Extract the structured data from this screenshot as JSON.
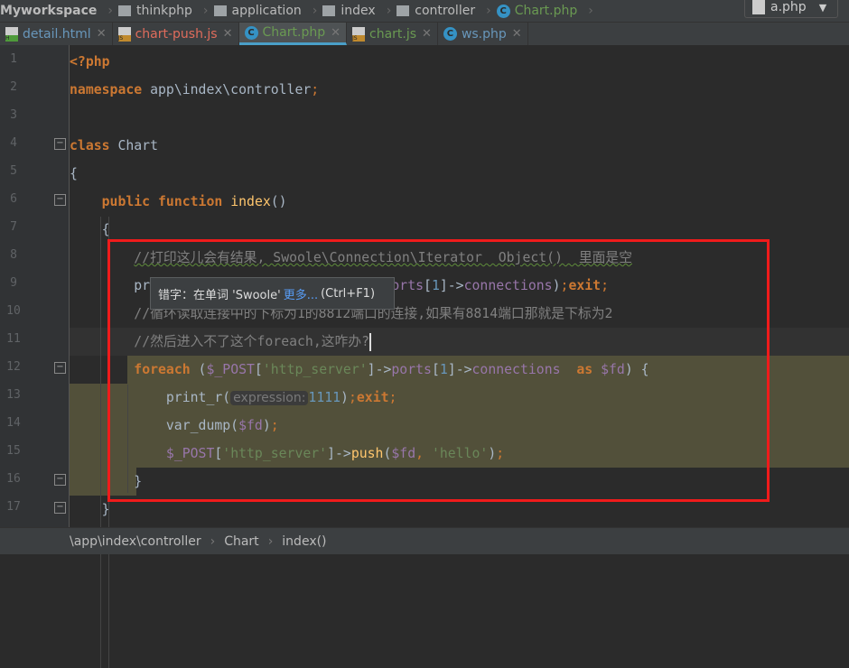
{
  "breadcrumb": {
    "items": [
      "Myworkspace",
      "thinkphp",
      "application",
      "index",
      "controller",
      "Chart.php"
    ]
  },
  "run_config": {
    "label": "a.php"
  },
  "tabs": [
    {
      "label": "detail.html",
      "color": "#6897bb",
      "icon": "html-file-icon",
      "badge": "H"
    },
    {
      "label": "chart-push.js",
      "color": "#e06c5c",
      "icon": "js-file-icon",
      "badge": "JS"
    },
    {
      "label": "Chart.php",
      "color": "#6a9a52",
      "icon": "php-class-icon",
      "badge": "C",
      "active": true
    },
    {
      "label": "chart.js",
      "color": "#6a9a52",
      "icon": "js-file-icon",
      "badge": "JS"
    },
    {
      "label": "ws.php",
      "color": "#6897bb",
      "icon": "php-class-icon",
      "badge": "C"
    }
  ],
  "line_numbers": [
    "1",
    "2",
    "3",
    "4",
    "5",
    "6",
    "7",
    "8",
    "9",
    "10",
    "11",
    "12",
    "13",
    "14",
    "15",
    "16",
    "17"
  ],
  "code": [
    [
      [
        "<?php",
        "tag"
      ]
    ],
    [
      [
        "namespace",
        "kw"
      ],
      [
        " app\\index\\controller",
        ""
      ],
      [
        ";",
        "semi"
      ]
    ],
    [],
    [
      [
        "class",
        "kw"
      ],
      [
        " Chart",
        ""
      ]
    ],
    [
      [
        "{",
        ""
      ]
    ],
    [
      [
        "    ",
        ""
      ],
      [
        "public",
        "kw"
      ],
      [
        " ",
        ""
      ],
      [
        "function",
        "kw"
      ],
      [
        " ",
        ""
      ],
      [
        "index",
        "fn"
      ],
      [
        "()",
        ""
      ]
    ],
    [
      [
        "    {",
        ""
      ]
    ],
    [
      [
        "        ",
        ""
      ],
      [
        "//打印这儿会有结果, Swoole\\Connection\\Iterator  Object()  里面是空",
        "cm"
      ]
    ],
    [
      [
        "        print_r(",
        ""
      ],
      [
        "$_POST",
        "var"
      ],
      [
        "[",
        ""
      ],
      [
        "'http_server'",
        "str"
      ],
      [
        "]->",
        ""
      ],
      [
        "ports",
        "var"
      ],
      [
        "[",
        ""
      ],
      [
        "1",
        "num"
      ],
      [
        "]->",
        ""
      ],
      [
        "connections",
        "var"
      ],
      [
        ")",
        ""
      ],
      [
        ";",
        "semi"
      ],
      [
        "exit",
        "kw"
      ],
      [
        ";",
        "semi"
      ]
    ],
    [
      [
        "        ",
        ""
      ],
      [
        "//循环读取连接中的下标为1的8812端口的连接,如果有8814端口那就是下标为2",
        "cm"
      ]
    ],
    [
      [
        "        ",
        ""
      ],
      [
        "//然后进入不了这个foreach,这咋办?",
        "cm"
      ]
    ],
    [
      [
        "        ",
        ""
      ],
      [
        "foreach",
        "kw"
      ],
      [
        " (",
        ""
      ],
      [
        "$_POST",
        "var"
      ],
      [
        "[",
        ""
      ],
      [
        "'http_server'",
        "str"
      ],
      [
        "]->",
        ""
      ],
      [
        "ports",
        "var"
      ],
      [
        "[",
        ""
      ],
      [
        "1",
        "num"
      ],
      [
        "]->",
        ""
      ],
      [
        "connections",
        "var"
      ],
      [
        "  ",
        ""
      ],
      [
        "as",
        "kw"
      ],
      [
        " ",
        ""
      ],
      [
        "$fd",
        "var"
      ],
      [
        ") {",
        ""
      ]
    ],
    [
      [
        "            print_r(",
        ""
      ],
      [
        "expression:",
        "hint"
      ],
      [
        "1111",
        "num"
      ],
      [
        ")",
        ""
      ],
      [
        ";",
        "semi"
      ],
      [
        "exit",
        "kw"
      ],
      [
        ";",
        "semi"
      ]
    ],
    [
      [
        "            var_dump(",
        ""
      ],
      [
        "$fd",
        "var"
      ],
      [
        ")",
        ""
      ],
      [
        ";",
        "semi"
      ]
    ],
    [
      [
        "            ",
        ""
      ],
      [
        "$_POST",
        "var"
      ],
      [
        "[",
        ""
      ],
      [
        "'http_server'",
        "str"
      ],
      [
        "]->",
        ""
      ],
      [
        "push",
        "fn"
      ],
      [
        "(",
        ""
      ],
      [
        "$fd",
        "var"
      ],
      [
        ", ",
        "semi"
      ],
      [
        "'hello'",
        "str"
      ],
      [
        ")",
        ""
      ],
      [
        ";",
        "semi"
      ]
    ],
    [
      [
        "        }",
        ""
      ]
    ],
    [
      [
        "    }",
        ""
      ]
    ]
  ],
  "tooltip": {
    "prefix": "错字：在单词 'Swoole' ",
    "more": "更多...",
    "shortcut": "(Ctrl+F1)"
  },
  "status_breadcrumb": [
    "\\app\\index\\controller",
    "Chart",
    "index()"
  ],
  "colors": {
    "annotation_box": "#f01b1b",
    "highlight": "#52503a",
    "background": "#2b2b2b"
  }
}
